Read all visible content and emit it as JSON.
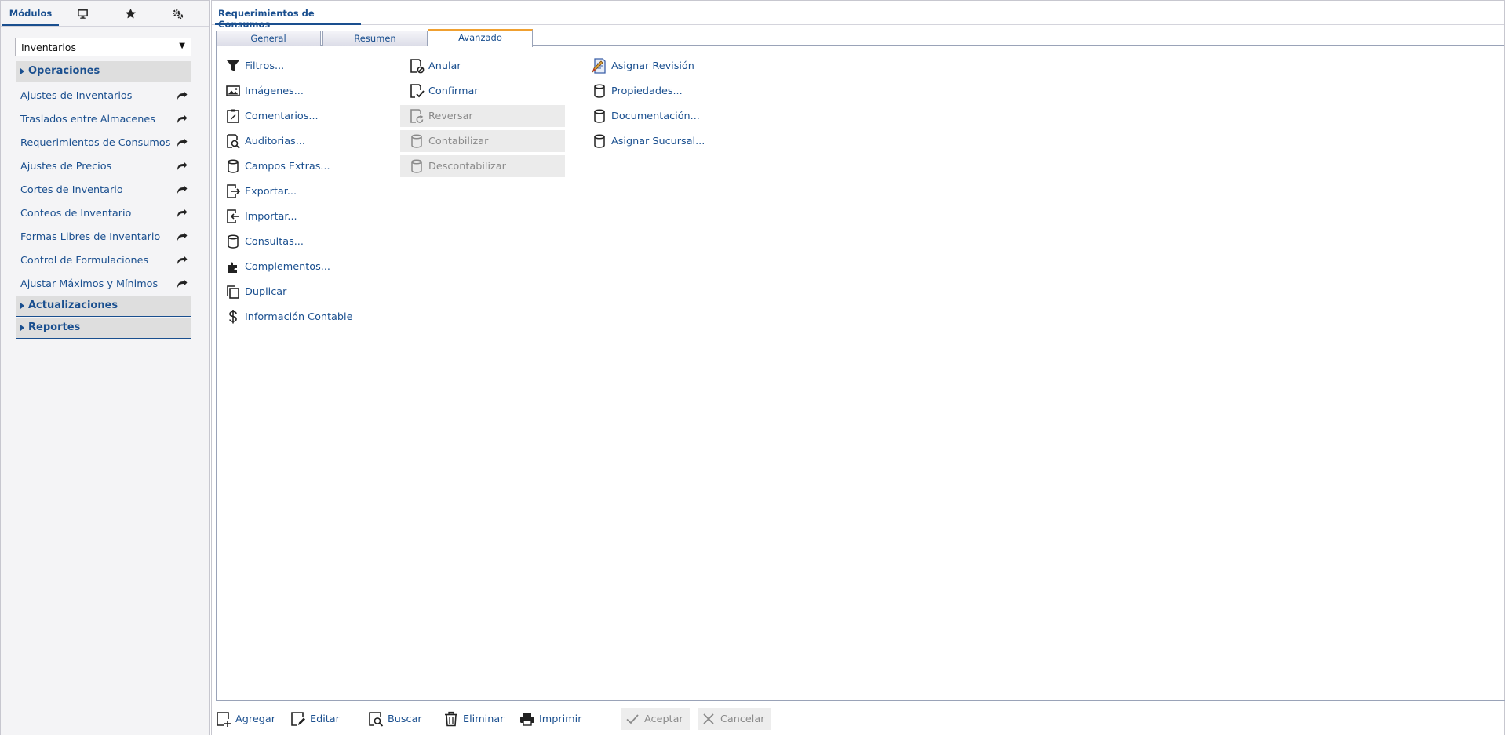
{
  "left": {
    "tabs": {
      "modules_label": "Módulos"
    },
    "module_select": {
      "value": "Inventarios"
    },
    "sections": {
      "operaciones": "Operaciones",
      "actualizaciones": "Actualizaciones",
      "reportes": "Reportes"
    },
    "items": [
      {
        "label": "Ajustes de Inventarios"
      },
      {
        "label": "Traslados entre Almacenes"
      },
      {
        "label": "Requerimientos de Consumos"
      },
      {
        "label": "Ajustes de Precios"
      },
      {
        "label": "Cortes de Inventario"
      },
      {
        "label": "Conteos de Inventario"
      },
      {
        "label": "Formas Libres de Inventario"
      },
      {
        "label": "Control de Formulaciones"
      },
      {
        "label": "Ajustar Máximos y Mínimos"
      }
    ]
  },
  "main": {
    "title": "Requerimientos de Consumos",
    "tabs": [
      {
        "label": "General"
      },
      {
        "label": "Resumen"
      },
      {
        "label": "Avanzado"
      }
    ],
    "col1": [
      {
        "label": "Filtros...",
        "icon": "filter-icon"
      },
      {
        "label": "Imágenes...",
        "icon": "image-icon"
      },
      {
        "label": "Comentarios...",
        "icon": "clipboard-icon"
      },
      {
        "label": "Auditorias...",
        "icon": "audit-icon"
      },
      {
        "label": "Campos Extras...",
        "icon": "database-icon"
      },
      {
        "label": "Exportar...",
        "icon": "export-icon"
      },
      {
        "label": "Importar...",
        "icon": "import-icon"
      },
      {
        "label": "Consultas...",
        "icon": "database-icon"
      },
      {
        "label": "Complementos...",
        "icon": "puzzle-icon"
      },
      {
        "label": "Duplicar",
        "icon": "copy-icon"
      },
      {
        "label": "Información Contable",
        "icon": "dollar-icon"
      }
    ],
    "col2": [
      {
        "label": "Anular",
        "icon": "void-document-icon"
      },
      {
        "label": "Confirmar",
        "icon": "confirm-document-icon"
      },
      {
        "label": "Reversar",
        "icon": "reverse-document-icon"
      },
      {
        "label": "Contabilizar",
        "icon": "database-icon"
      },
      {
        "label": "Descontabilizar",
        "icon": "database-icon"
      }
    ],
    "col3": [
      {
        "label": "Asignar Revisión",
        "icon": "revision-icon"
      },
      {
        "label": "Propiedades...",
        "icon": "database-icon"
      },
      {
        "label": "Documentación...",
        "icon": "database-icon"
      },
      {
        "label": "Asignar Sucursal...",
        "icon": "database-icon"
      }
    ]
  },
  "toolbar": {
    "add": "Agregar",
    "edit": "Editar",
    "search": "Buscar",
    "delete": "Eliminar",
    "print": "Imprimir",
    "accept": "Aceptar",
    "cancel": "Cancelar"
  },
  "colors": {
    "accent": "#1a4f8f",
    "active_tab": "#f0a030",
    "disabled_bg": "#ebebeb",
    "disabled_text": "#8a8a8a"
  }
}
